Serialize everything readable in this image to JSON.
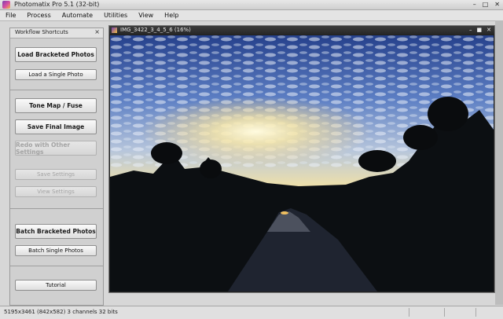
{
  "window": {
    "title": "Photomatix Pro 5.1 (32-bit)",
    "min": "–",
    "max": "□",
    "close": "✕"
  },
  "menu": [
    "File",
    "Process",
    "Automate",
    "Utilities",
    "View",
    "Help"
  ],
  "workflow": {
    "title": "Workflow Shortcuts",
    "close": "×",
    "load_bracketed": "Load Bracketed Photos",
    "load_single": "Load a Single Photo",
    "tone_map": "Tone Map / Fuse",
    "save_final": "Save Final Image",
    "redo": "Redo with Other Settings",
    "save_settings": "Save Settings",
    "view_settings": "View Settings",
    "batch_bracketed": "Batch Bracketed Photos",
    "batch_single": "Batch Single Photos",
    "tutorial": "Tutorial"
  },
  "document": {
    "title": "IMG_3422_3_4_5_6 (16%)",
    "min": "–",
    "max": "■",
    "close": "✕"
  },
  "status": {
    "text": "5195x3461 (842x582) 3 channels 32 bits"
  }
}
